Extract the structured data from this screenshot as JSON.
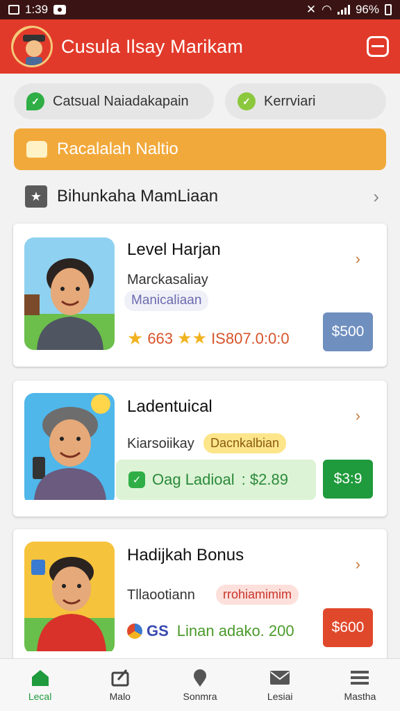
{
  "status": {
    "time": "1:39",
    "battery": "96%"
  },
  "app": {
    "title": "Cusula Ilsay Marikam"
  },
  "chips": [
    {
      "label": "Catsual Naiadakapain"
    },
    {
      "label": "Kerrviari"
    }
  ],
  "banner": {
    "label": "Racalalah Naltio"
  },
  "section": {
    "label": "Bihunkaha MamLiaan"
  },
  "cards": [
    {
      "title": "Level Harjan",
      "subtitle": "Marckasaliay",
      "tag": "Manicaliaan",
      "rating": "663",
      "amount": "IS807.0:0:0",
      "price": "$500",
      "price_color": "#6f8fbf"
    },
    {
      "title": "Ladentuical",
      "subtitle": "Kiarsoiikay",
      "tag": "Dacnkalbian",
      "offer": "Oag Ladioal",
      "offer_amount": ": $2.89",
      "price": "$3:9",
      "price_color": "#1f9a3c"
    },
    {
      "title": "Hadijkah Bonus",
      "subtitle": "Tllaootiann",
      "tag": "rrohiamimim",
      "code": "GS",
      "extra": "Linan adako. 200",
      "price": "$600",
      "price_color": "#e0482b"
    }
  ],
  "nav": [
    {
      "label": "Lecal",
      "active": true
    },
    {
      "label": "Malo"
    },
    {
      "label": "Sonmra"
    },
    {
      "label": "Lesiai"
    },
    {
      "label": "Mastha"
    }
  ],
  "colors": {
    "app_bar": "#e23a2a",
    "banner": "#f2a93b",
    "active_nav": "#1f9a3c"
  }
}
